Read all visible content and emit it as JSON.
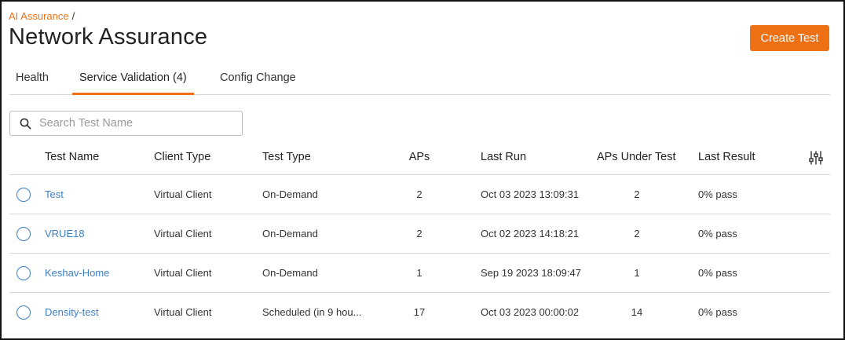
{
  "breadcrumb": {
    "root": "AI Assurance",
    "separator": "/"
  },
  "page": {
    "title": "Network Assurance"
  },
  "actions": {
    "create_test_label": "Create Test"
  },
  "tabs": [
    {
      "label": "Health",
      "active": false
    },
    {
      "label": "Service Validation (4)",
      "active": true
    },
    {
      "label": "Config Change",
      "active": false
    }
  ],
  "search": {
    "placeholder": "Search Test Name",
    "value": ""
  },
  "table": {
    "columns": [
      "Test Name",
      "Client Type",
      "Test Type",
      "APs",
      "Last Run",
      "APs Under Test",
      "Last Result"
    ],
    "rows": [
      {
        "name": "Test",
        "client_type": "Virtual Client",
        "test_type": "On-Demand",
        "aps": "2",
        "last_run": "Oct 03 2023 13:09:31",
        "aps_under_test": "2",
        "last_result": "0% pass"
      },
      {
        "name": "VRUE18",
        "client_type": "Virtual Client",
        "test_type": "On-Demand",
        "aps": "2",
        "last_run": "Oct 02 2023 14:18:21",
        "aps_under_test": "2",
        "last_result": "0% pass"
      },
      {
        "name": "Keshav-Home",
        "client_type": "Virtual Client",
        "test_type": "On-Demand",
        "aps": "1",
        "last_run": "Sep 19 2023 18:09:47",
        "aps_under_test": "1",
        "last_result": "0% pass"
      },
      {
        "name": "Density-test",
        "client_type": "Virtual Client",
        "test_type": "Scheduled (in 9 hou...",
        "aps": "17",
        "last_run": "Oct 03 2023 00:00:02",
        "aps_under_test": "14",
        "last_result": "0% pass"
      }
    ]
  },
  "colors": {
    "accent": "#ed7015",
    "link": "#3c7fc6"
  },
  "icons": {
    "search": "search-icon",
    "column_settings": "sliders-icon",
    "row_select": "radio-icon"
  }
}
